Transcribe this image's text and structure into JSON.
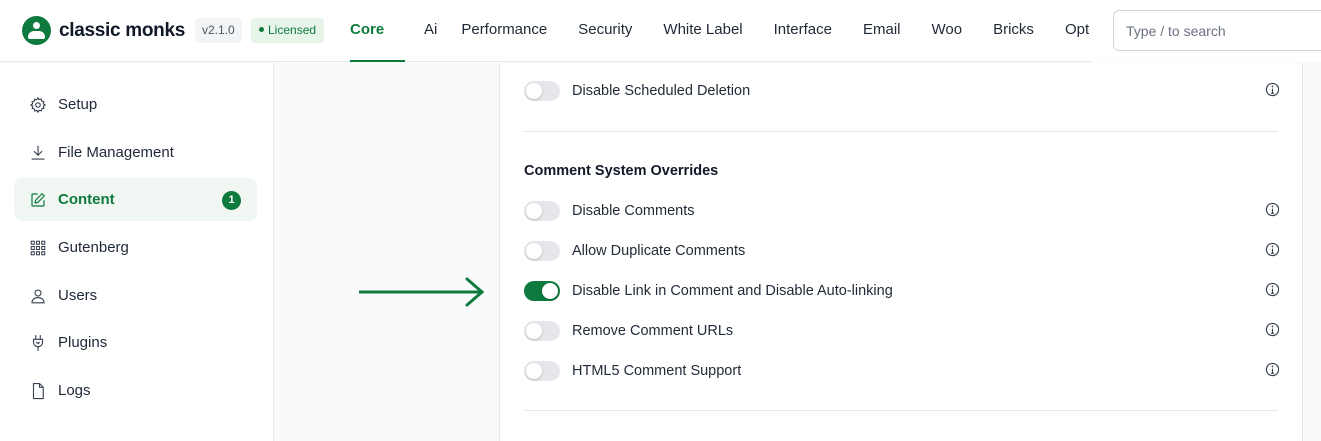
{
  "header": {
    "brand": "classic monks",
    "version": "v2.1.0",
    "license": "Licensed",
    "tabs": [
      {
        "label": "Core",
        "active": true
      },
      {
        "label": "Ai"
      },
      {
        "label": "Performance"
      },
      {
        "label": "Security"
      },
      {
        "label": "White Label"
      },
      {
        "label": "Interface"
      },
      {
        "label": "Email"
      },
      {
        "label": "Woo"
      },
      {
        "label": "Bricks"
      },
      {
        "label": "Opt"
      }
    ],
    "search_placeholder": "Type / to search"
  },
  "sidebar": {
    "items": [
      {
        "label": "Setup",
        "icon": "gear-icon"
      },
      {
        "label": "File Management",
        "icon": "download-icon"
      },
      {
        "label": "Content",
        "icon": "edit-icon",
        "active": true,
        "badge": "1"
      },
      {
        "label": "Gutenberg",
        "icon": "grid-icon"
      },
      {
        "label": "Users",
        "icon": "user-icon"
      },
      {
        "label": "Plugins",
        "icon": "plug-icon"
      },
      {
        "label": "Logs",
        "icon": "file-icon"
      }
    ]
  },
  "content": {
    "top_setting": {
      "label": "Disable Scheduled Deletion",
      "on": false
    },
    "section_title": "Comment System Overrides",
    "settings": [
      {
        "label": "Disable Comments",
        "on": false
      },
      {
        "label": "Allow Duplicate Comments",
        "on": false
      },
      {
        "label": "Disable Link in Comment and Disable Auto-linking",
        "on": true
      },
      {
        "label": "Remove Comment URLs",
        "on": false
      },
      {
        "label": "HTML5 Comment Support",
        "on": false
      }
    ]
  },
  "colors": {
    "accent": "#0f7a3d",
    "toggle_off": "#e5e7eb",
    "active_bg": "#f0f6f2"
  }
}
